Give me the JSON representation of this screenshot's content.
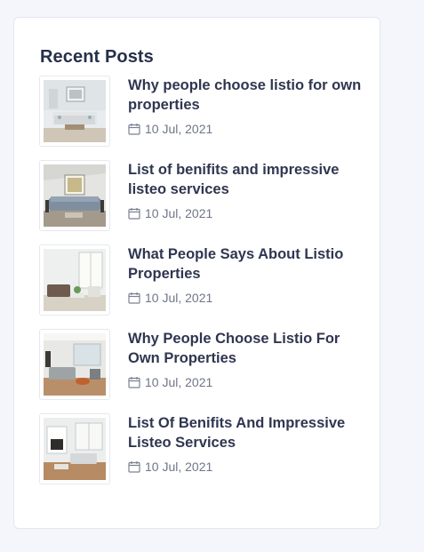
{
  "widget": {
    "title": "Recent Posts"
  },
  "posts": [
    {
      "title": "Why people choose listio for own properties",
      "date": "10 Jul, 2021",
      "thumb_icon": "living-room-photo"
    },
    {
      "title": "List of benifits and impressive listeo services",
      "date": "10 Jul, 2021",
      "thumb_icon": "living-room-photo"
    },
    {
      "title": "What People Says About Listio Properties",
      "date": "10 Jul, 2021",
      "thumb_icon": "living-room-photo"
    },
    {
      "title": "Why People Choose Listio For Own Properties",
      "date": "10 Jul, 2021",
      "thumb_icon": "living-room-photo"
    },
    {
      "title": "List Of Benifits And Impressive Listeo Services",
      "date": "10 Jul, 2021",
      "thumb_icon": "living-room-photo"
    }
  ],
  "icons": {
    "date": "calendar-icon"
  },
  "colors": {
    "title": "#26304a",
    "post_title": "#2f3650",
    "meta": "#6f7689",
    "card_border": "#e3e6ef",
    "page_bg": "#f5f6fb"
  }
}
